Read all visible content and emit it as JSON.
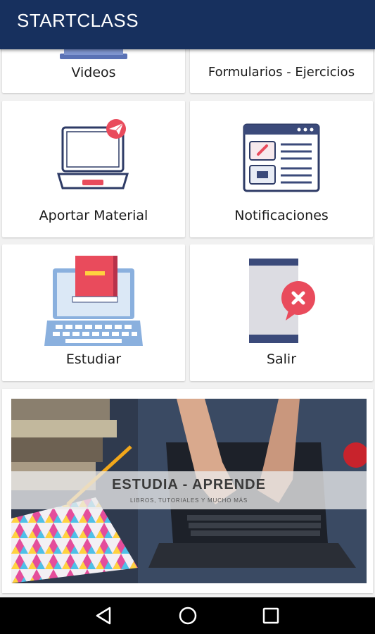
{
  "app": {
    "title": "STARTCLASS"
  },
  "menu": {
    "videos": "Videos",
    "forms": "Formularios - Ejercicios",
    "contribute": "Aportar Material",
    "notifications": "Notificaciones",
    "study": "Estudiar",
    "exit": "Salir"
  },
  "banner": {
    "title": "ESTUDIA - APRENDE",
    "subtitle": "LIBROS, TUTORIALES Y MUCHO MÁS"
  },
  "icons": {
    "laptop": "laptop-icon",
    "browser": "browser-window-icon",
    "book_laptop": "book-laptop-icon",
    "phone_close": "phone-close-icon"
  },
  "colors": {
    "appbar": "#17305e",
    "accent_red": "#e94b5c",
    "navy": "#3b4a7a"
  }
}
